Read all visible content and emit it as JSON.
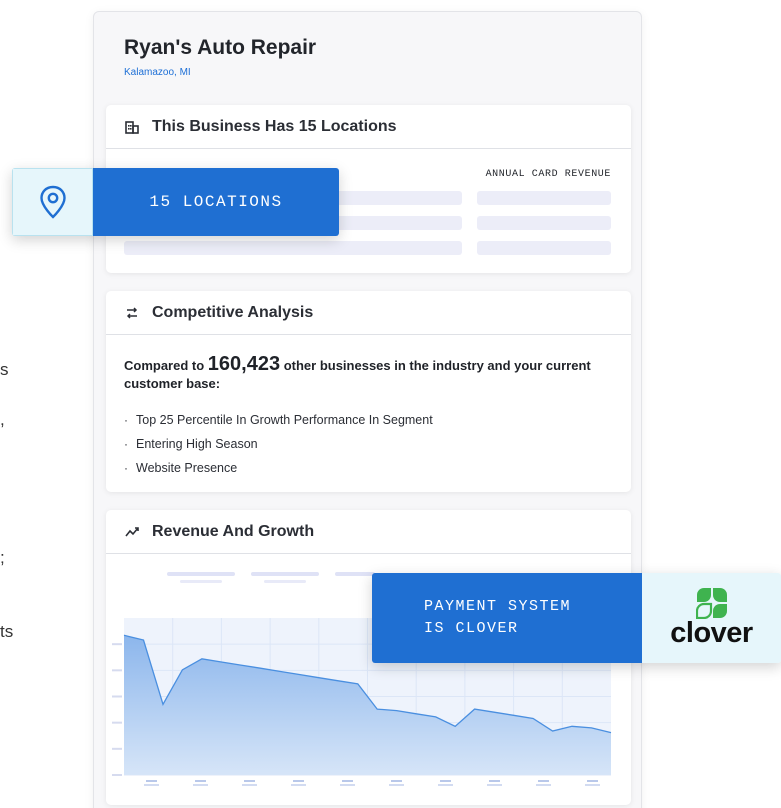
{
  "left_fragments": [
    "s",
    ",",
    ";",
    "ts"
  ],
  "business": {
    "name": "Ryan's Auto Repair",
    "location": "Kalamazoo, MI"
  },
  "locations_card": {
    "title": "This Business Has 15 Locations",
    "column_header": "ANNUAL CARD REVENUE",
    "icon": "building-icon"
  },
  "competitive_card": {
    "title": "Competitive Analysis",
    "icon": "compare-arrows-icon",
    "intro_prefix": "Compared to ",
    "count": "160,423",
    "intro_suffix": " other businesses in the industry and your current customer base:",
    "bullets": [
      "Top 25 Percentile In Growth Performance In Segment",
      "Entering High Season",
      "Website Presence"
    ]
  },
  "revenue_card": {
    "title": "Revenue And Growth",
    "icon": "trend-up-icon"
  },
  "badges": {
    "locations": "15 LOCATIONS",
    "locations_icon": "map-pin-icon",
    "payment_line1": "PAYMENT SYSTEM",
    "payment_line2": "IS CLOVER",
    "brand_word": "clover",
    "brand_icon": "clover-logo-icon"
  },
  "colors": {
    "accent_blue": "#1f6fd2",
    "badge_light": "#e6f6fb",
    "area_fill": "#9cc2ee",
    "line_stroke": "#4a8fe0"
  },
  "chart_data": {
    "type": "area",
    "title": "Revenue And Growth",
    "xlabel": "",
    "ylabel": "",
    "grid": true,
    "ylim": [
      0,
      100
    ],
    "x": [
      0,
      1,
      2,
      3,
      4,
      5,
      6,
      7,
      8,
      9,
      10,
      11,
      12,
      13,
      14,
      15,
      16,
      17,
      18,
      19,
      20,
      21,
      22,
      23,
      24,
      25
    ],
    "series": [
      {
        "values": [
          89,
          86,
          45,
          67,
          74,
          72,
          70,
          68,
          66,
          64,
          62,
          60,
          58,
          42,
          41,
          39,
          37,
          31,
          42,
          40,
          38,
          36,
          28,
          31,
          30,
          27
        ]
      }
    ]
  }
}
